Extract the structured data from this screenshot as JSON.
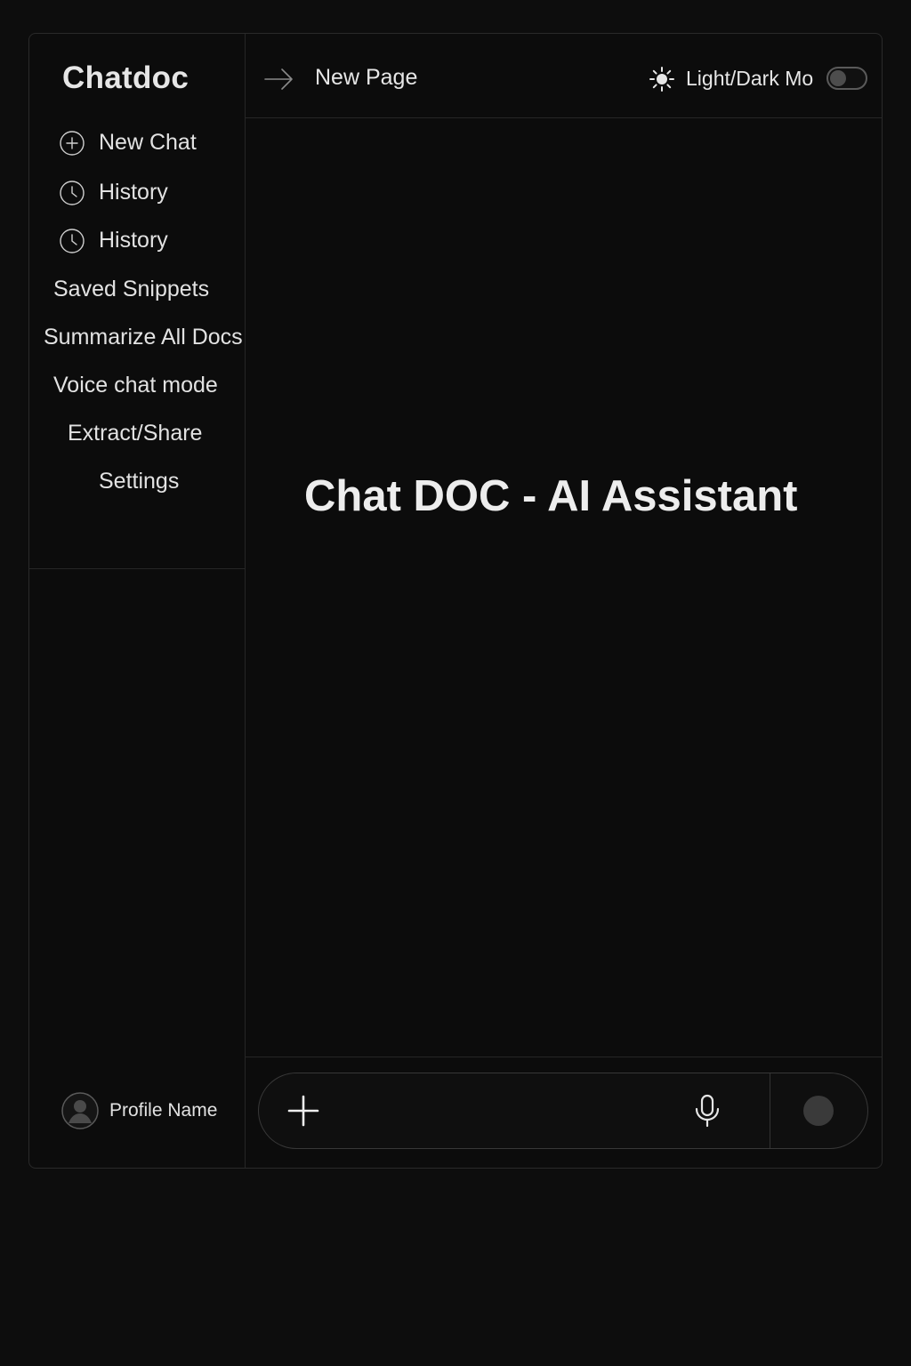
{
  "sidebar": {
    "brand": "Chatdoc",
    "items": [
      {
        "label": "New Chat",
        "icon": "plus-circle-icon"
      },
      {
        "label": "History",
        "icon": "clock-icon"
      },
      {
        "label": "History",
        "icon": "clock-icon"
      },
      {
        "label": "Saved Snippets"
      },
      {
        "label": "Summarize All Docs"
      },
      {
        "label": "Voice chat mode"
      },
      {
        "label": "Extract/Share"
      },
      {
        "label": "Settings"
      }
    ],
    "profile": {
      "name": "Profile Name",
      "icon": "avatar-icon"
    }
  },
  "topbar": {
    "page_title": "New Page",
    "nav_icon": "arrow-right-icon",
    "mode_icon": "sun-icon",
    "mode_label": "Light/Dark Mo",
    "mode_toggle_on": false
  },
  "main": {
    "hero_title": "Chat DOC - AI Assistant"
  },
  "composer": {
    "placeholder": "",
    "add_icon": "plus-icon",
    "mic_icon": "microphone-icon",
    "send_icon": "send-dot-icon"
  },
  "colors": {
    "background": "#0d0d0d",
    "panel": "#0c0c0c",
    "border": "#262626",
    "text": "#e6e6e6",
    "toggle_knob": "#4d4d4d",
    "send_button": "#3a3a3a"
  }
}
